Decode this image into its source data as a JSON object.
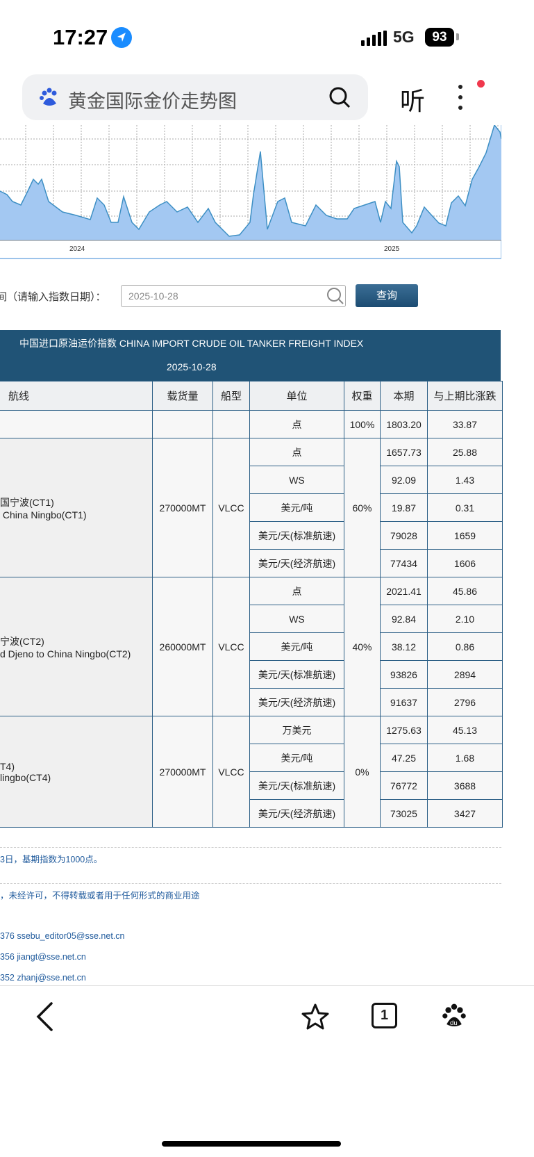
{
  "status": {
    "time": "17:27",
    "network": "5G",
    "battery": "93"
  },
  "search": {
    "placeholder": "黄金国际金价走势图",
    "listen_label": "听"
  },
  "chart": {
    "x_ticks": [
      "2024",
      "2025"
    ],
    "fill": "#a3c8f2",
    "line": "#3d8fc4"
  },
  "query": {
    "label": "间（请输入指数日期）：",
    "date_value": "2025-10-28",
    "button": "查询"
  },
  "index": {
    "title": "中国进口原油运价指数 CHINA IMPORT CRUDE OIL TANKER FREIGHT INDEX",
    "date": "2025-10-28"
  },
  "columns": [
    "航线",
    "载货量",
    "船型",
    "单位",
    "权重",
    "本期",
    "与上期比涨跌"
  ],
  "total": {
    "unit": "点",
    "weight": "100%",
    "current": "1803.20",
    "change": "33.87"
  },
  "routes": [
    {
      "name_cn": "国宁波(CT1)",
      "name_en": " China Ningbo(CT1)",
      "cargo": "270000MT",
      "ship": "VLCC",
      "weight": "60%",
      "rows": [
        {
          "unit": "点",
          "current": "1657.73",
          "change": "25.88"
        },
        {
          "unit": "WS",
          "current": "92.09",
          "change": "1.43"
        },
        {
          "unit": "美元/吨",
          "current": "19.87",
          "change": "0.31"
        },
        {
          "unit": "美元/天(标准航速)",
          "current": "79028",
          "change": "1659"
        },
        {
          "unit": "美元/天(经济航速)",
          "current": "77434",
          "change": "1606"
        }
      ]
    },
    {
      "name_cn": "宁波(CT2)",
      "name_en": "d Djeno to China Ningbo(CT2)",
      "cargo": "260000MT",
      "ship": "VLCC",
      "weight": "40%",
      "rows": [
        {
          "unit": "点",
          "current": "2021.41",
          "change": "45.86"
        },
        {
          "unit": "WS",
          "current": "92.84",
          "change": "2.10"
        },
        {
          "unit": "美元/吨",
          "current": "38.12",
          "change": "0.86"
        },
        {
          "unit": "美元/天(标准航速)",
          "current": "93826",
          "change": "2894"
        },
        {
          "unit": "美元/天(经济航速)",
          "current": "91637",
          "change": "2796"
        }
      ]
    },
    {
      "name_cn": "T4)",
      "name_en": "lingbo(CT4)",
      "cargo": "270000MT",
      "ship": "VLCC",
      "weight": "0%",
      "rows": [
        {
          "unit": "万美元",
          "current": "1275.63",
          "change": "45.13"
        },
        {
          "unit": "美元/吨",
          "current": "47.25",
          "change": "1.68"
        },
        {
          "unit": "美元/天(标准航速)",
          "current": "76772",
          "change": "3688"
        },
        {
          "unit": "美元/天(经济航速)",
          "current": "73025",
          "change": "3427"
        }
      ]
    }
  ],
  "footer": {
    "note1": "3日，基期指数为1000点。",
    "note2": "，未经许可，不得转载或者用于任何形式的商业用途",
    "contacts": [
      "376 ssebu_editor05@sse.net.cn",
      "356 jiangt@sse.net.cn",
      "352 zhanj@sse.net.cn"
    ]
  },
  "bottom_nav": {
    "tab_count": "1"
  }
}
